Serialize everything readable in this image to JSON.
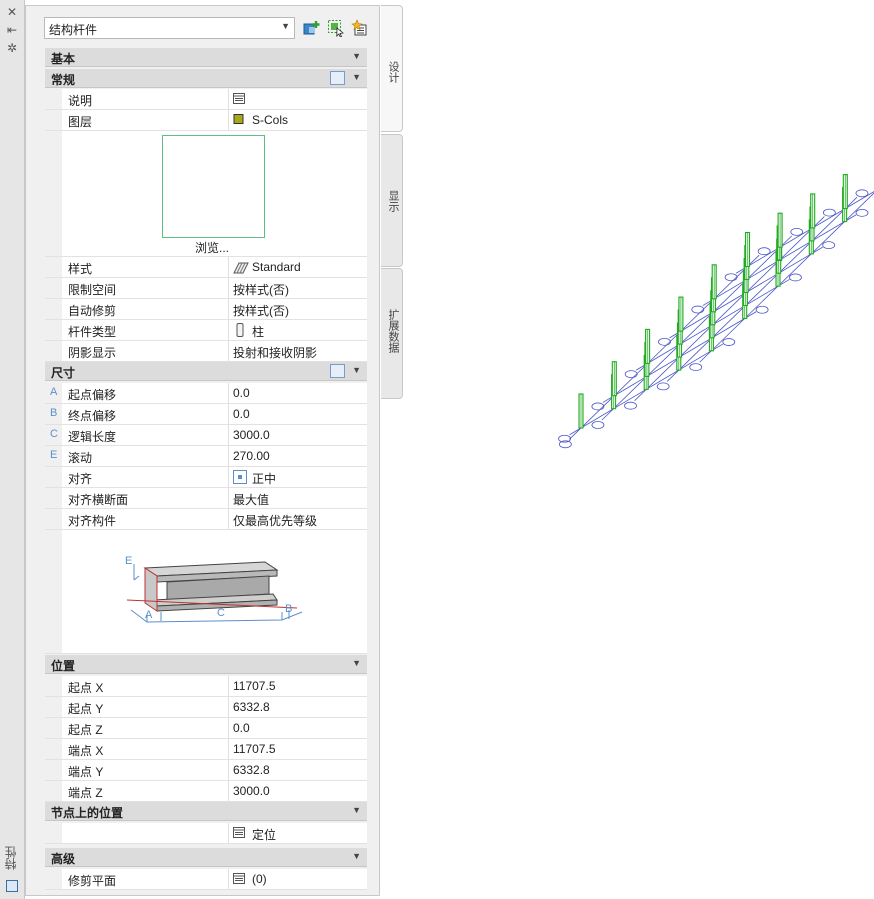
{
  "panel_title": "特性",
  "style_dropdown": {
    "value": "结构杆件"
  },
  "tabs": [
    {
      "label": "设计"
    },
    {
      "label": "显示"
    },
    {
      "label": "扩展数据"
    }
  ],
  "sections": {
    "basic": "基本",
    "general": "常规",
    "dimensions": "尺寸",
    "location": "位置",
    "node_location": "节点上的位置",
    "advanced": "高级"
  },
  "general": {
    "description": {
      "label": "说明",
      "value": ""
    },
    "layer": {
      "label": "图层",
      "value": "S-Cols",
      "color": "#a8a818"
    },
    "browse_label": "浏览...",
    "style": {
      "label": "样式",
      "value": "Standard"
    },
    "limit_space": {
      "label": "限制空间",
      "value": "按样式(否)"
    },
    "auto_trim": {
      "label": "自动修剪",
      "value": "按样式(否)"
    },
    "member_type": {
      "label": "杆件类型",
      "value": "柱"
    },
    "shadow": {
      "label": "阴影显示",
      "value": "投射和接收阴影"
    }
  },
  "dimensions": {
    "start_offset": {
      "marker": "A",
      "label": "起点偏移",
      "value": "0.0"
    },
    "end_offset": {
      "marker": "B",
      "label": "终点偏移",
      "value": "0.0"
    },
    "logical_length": {
      "marker": "C",
      "label": "逻辑长度",
      "value": "3000.0"
    },
    "roll": {
      "marker": "E",
      "label": "滚动",
      "value": "270.00"
    },
    "justify": {
      "label": "对齐",
      "value": "正中"
    },
    "justify_section": {
      "label": "对齐横断面",
      "value": "最大值"
    },
    "justify_component": {
      "label": "对齐构件",
      "value": "仅最高优先等级"
    }
  },
  "diagram_labels": {
    "A": "A",
    "B": "B",
    "C": "C",
    "E": "E"
  },
  "location": {
    "start_x": {
      "label": "起点 X",
      "value": "11707.5"
    },
    "start_y": {
      "label": "起点 Y",
      "value": "6332.8"
    },
    "start_z": {
      "label": "起点 Z",
      "value": "0.0"
    },
    "end_x": {
      "label": "端点 X",
      "value": "11707.5"
    },
    "end_y": {
      "label": "端点 Y",
      "value": "6332.8"
    },
    "end_z": {
      "label": "端点 Z",
      "value": "3000.0"
    }
  },
  "node_location": {
    "value": "定位"
  },
  "advanced": {
    "trim_planes": {
      "label": "修剪平面",
      "value": "(0)"
    }
  },
  "colors": {
    "grid": "#4a55c8",
    "column": "#22aa22",
    "accent": "#5b8fcc"
  }
}
